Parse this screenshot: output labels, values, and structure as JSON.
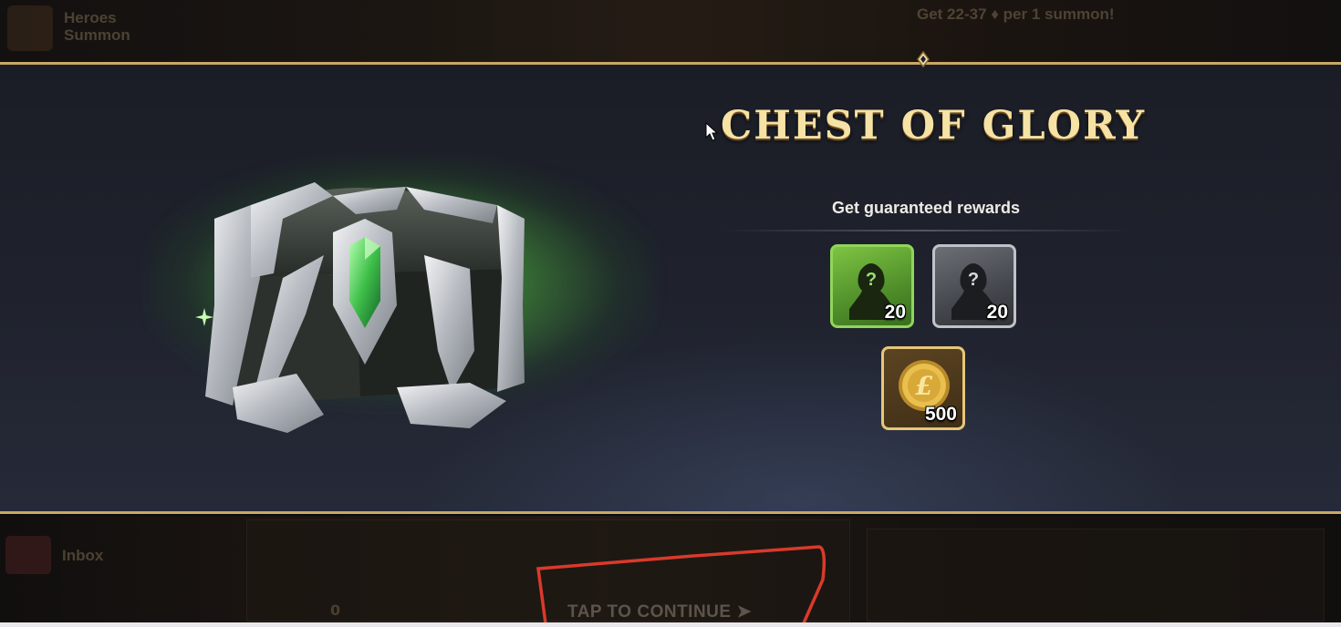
{
  "background": {
    "top_left_label": "Heroes Summon",
    "top_promo_text": "Get 22-37 ♦ per 1 summon!",
    "inbox_label": "Inbox",
    "counter_value": "0",
    "tap_to_continue": "TAP TO CONTINUE"
  },
  "modal": {
    "title": "CHEST OF GLORY",
    "subtitle": "Get guaranteed rewards",
    "rewards": [
      {
        "type": "uncommon-hero-shard",
        "icon": "mystery-hero-icon",
        "count": "20",
        "color": "#8fd65a"
      },
      {
        "type": "common-hero-shard",
        "icon": "mystery-hero-icon",
        "count": "20",
        "color": "#bfc2c8"
      },
      {
        "type": "gold-coin",
        "icon": "gold-coin-icon",
        "count": "500",
        "color": "#e6c77a"
      }
    ]
  },
  "colors": {
    "accent_gold": "#c9a864",
    "title_gold": "#f6e2a4",
    "chest_glow": "#78e65a"
  }
}
